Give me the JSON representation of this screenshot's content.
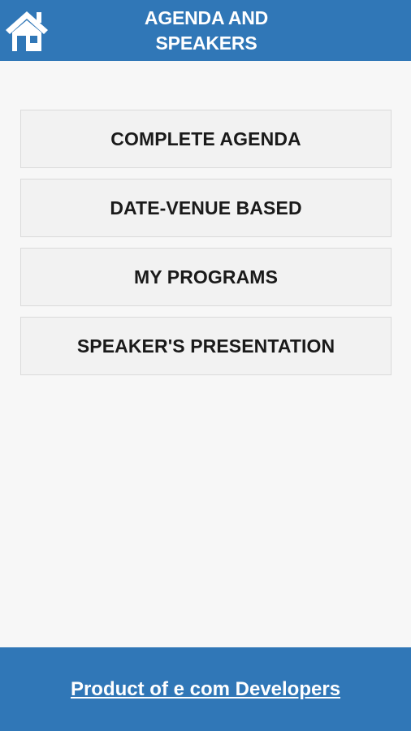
{
  "header": {
    "title_line1": "AGENDA AND",
    "title_line2": "SPEAKERS",
    "home_icon": "home-icon",
    "bg_color": "#3077b7"
  },
  "menu": {
    "items": [
      {
        "label": "COMPLETE AGENDA"
      },
      {
        "label": "DATE-VENUE BASED"
      },
      {
        "label": "MY PROGRAMS"
      },
      {
        "label": "SPEAKER'S PRESENTATION"
      }
    ]
  },
  "footer": {
    "link_text": "Product of e com Developers"
  }
}
